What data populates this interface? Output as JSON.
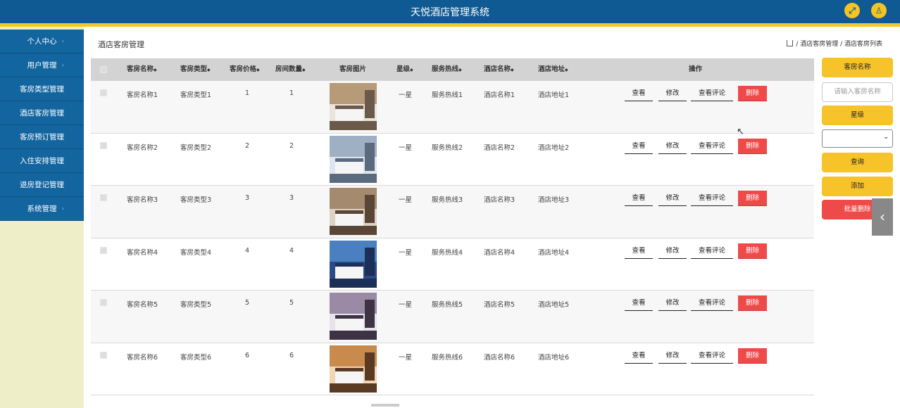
{
  "app_title": "天悦酒店管理系统",
  "header_icons": [
    "fullscreen-icon",
    "user-icon"
  ],
  "sidebar": {
    "items": [
      {
        "label": "个人中心",
        "has_caret": true
      },
      {
        "label": "用户管理",
        "has_caret": true
      },
      {
        "label": "客房类型管理",
        "has_caret": false
      },
      {
        "label": "酒店客房管理",
        "has_caret": false
      },
      {
        "label": "客房预订管理",
        "has_caret": false
      },
      {
        "label": "入住安排管理",
        "has_caret": false
      },
      {
        "label": "退房登记管理",
        "has_caret": false
      },
      {
        "label": "系统管理",
        "has_caret": true
      }
    ]
  },
  "page": {
    "title": "酒店客房管理",
    "breadcrumb": "/ 酒店客房管理 / 酒店客房列表"
  },
  "table": {
    "headers": [
      "客房名称",
      "客房类型",
      "客房价格",
      "房间数量",
      "客房图片",
      "星级",
      "服务热线",
      "酒店名称",
      "酒店地址",
      "操作"
    ],
    "rows": [
      {
        "name": "客房名称1",
        "type": "客房类型1",
        "price": "1",
        "count": "1",
        "stars": "一星",
        "hotline": "服务热线1",
        "hotel": "酒店名称1",
        "address": "酒店地址1"
      },
      {
        "name": "客房名称2",
        "type": "客房类型2",
        "price": "2",
        "count": "2",
        "stars": "一星",
        "hotline": "服务热线2",
        "hotel": "酒店名称2",
        "address": "酒店地址2"
      },
      {
        "name": "客房名称3",
        "type": "客房类型3",
        "price": "3",
        "count": "3",
        "stars": "一星",
        "hotline": "服务热线3",
        "hotel": "酒店名称3",
        "address": "酒店地址3"
      },
      {
        "name": "客房名称4",
        "type": "客房类型4",
        "price": "4",
        "count": "4",
        "stars": "一星",
        "hotline": "服务热线4",
        "hotel": "酒店名称4",
        "address": "酒店地址4"
      },
      {
        "name": "客房名称5",
        "type": "客房类型5",
        "price": "5",
        "count": "5",
        "stars": "一星",
        "hotline": "服务热线5",
        "hotel": "酒店名称5",
        "address": "酒店地址5"
      },
      {
        "name": "客房名称6",
        "type": "客房类型6",
        "price": "6",
        "count": "6",
        "stars": "一星",
        "hotline": "服务热线6",
        "hotel": "酒店名称6",
        "address": "酒店地址6"
      }
    ],
    "actions": {
      "view": "查看",
      "edit": "修改",
      "reviews": "查看评论",
      "delete": "删除"
    }
  },
  "search_panel": {
    "room_name_label": "客房名称",
    "room_name_placeholder": "请输入客房名称",
    "star_label": "星级",
    "star_selected": "",
    "query_button": "查询",
    "add_button": "添加",
    "batch_delete_button": "批量删除"
  },
  "colors": {
    "header_blue": "#0f5a92",
    "accent_gold": "#f3c826",
    "sidebar_blue": "#13659f",
    "delete_red": "#ef4a4a"
  }
}
